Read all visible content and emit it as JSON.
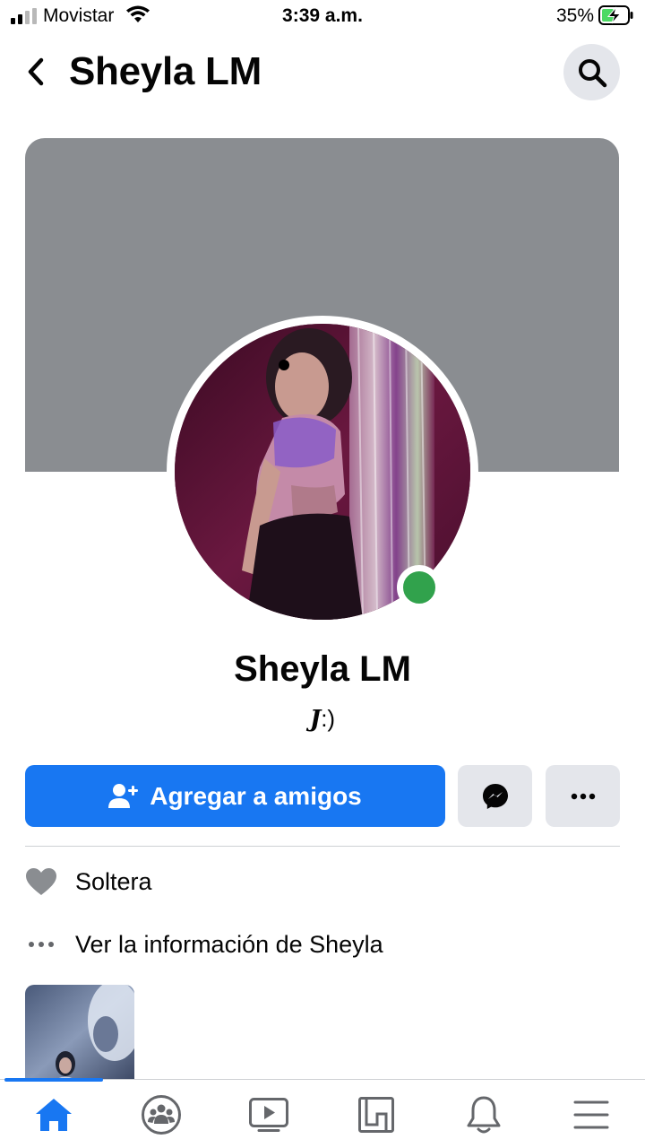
{
  "status_bar": {
    "carrier": "Movistar",
    "time": "3:39 a.m.",
    "battery": "35%"
  },
  "header": {
    "title": "Sheyla LM"
  },
  "profile": {
    "name": "Sheyla LM",
    "bio_letter": "J",
    "bio_rest": ":)",
    "online": true
  },
  "actions": {
    "add_friend_label": "Agregar a amigos"
  },
  "info": {
    "relationship": "Soltera",
    "see_about": "Ver la información de Sheyla"
  },
  "nav": {
    "items": [
      "home-icon",
      "groups-icon",
      "watch-icon",
      "marketplace-icon",
      "notifications-icon",
      "menu-icon"
    ],
    "active": "home-icon"
  },
  "colors": {
    "primary": "#1877f2",
    "secondary_button": "#e4e6eb",
    "cover": "#8a8d91",
    "online": "#31a24c",
    "battery_charging": "#4cd964"
  }
}
